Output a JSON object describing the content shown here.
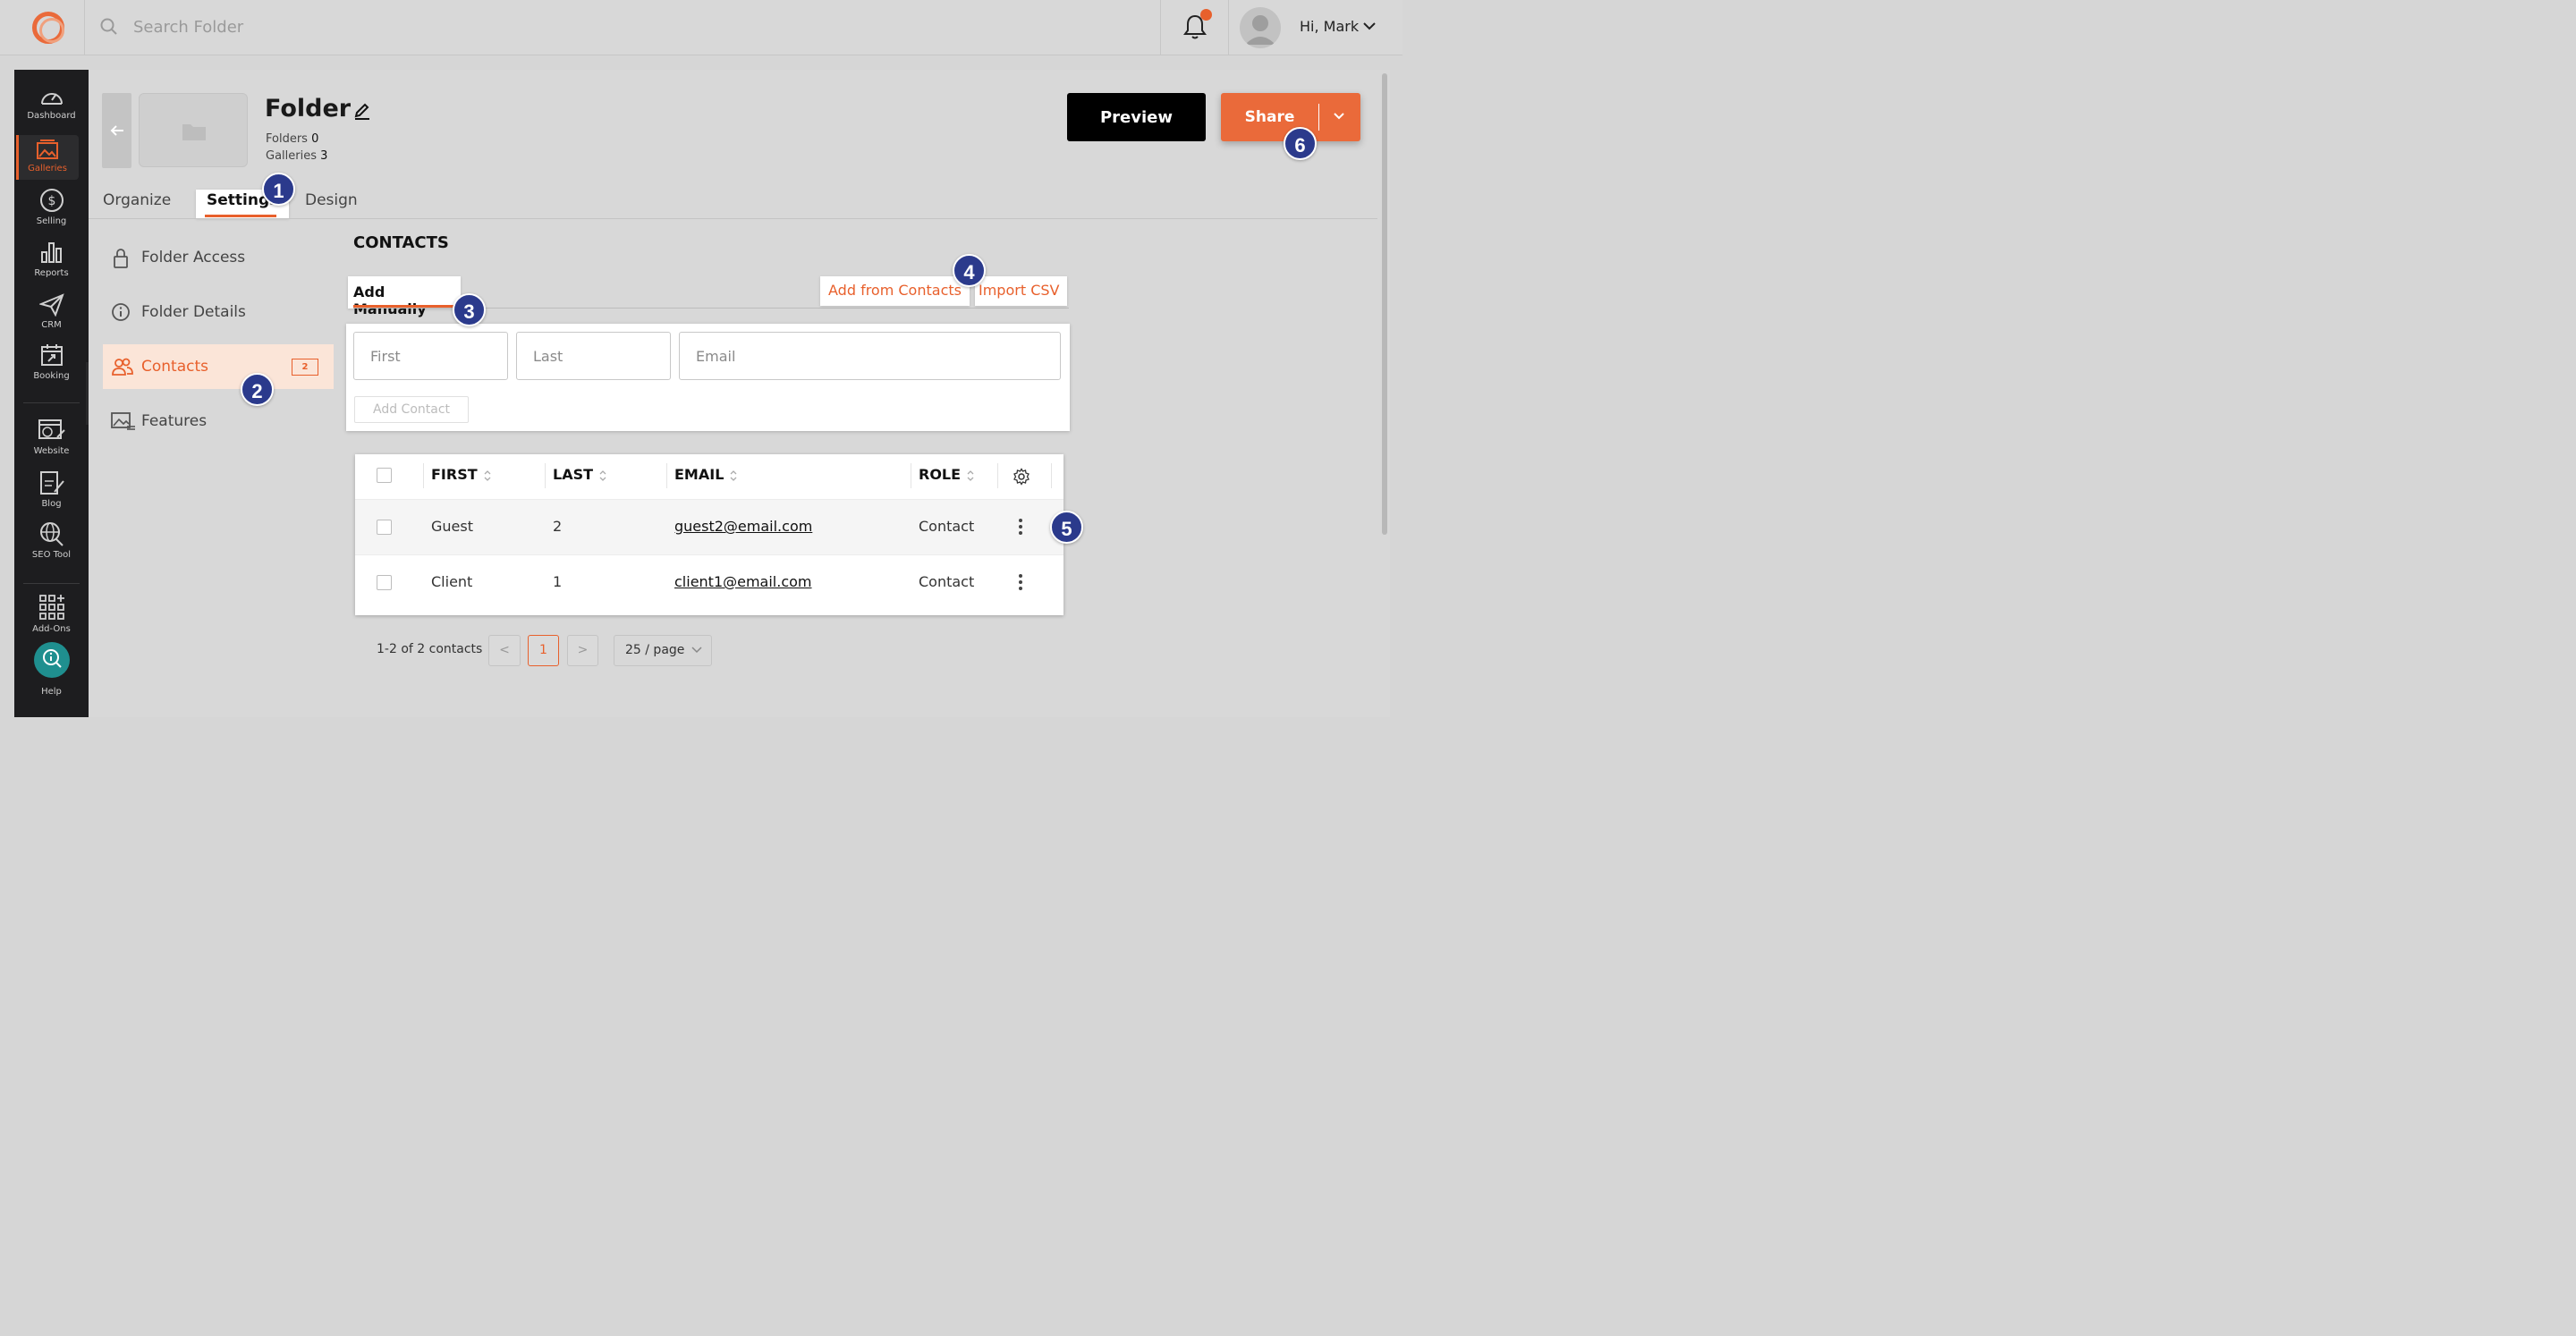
{
  "topbar": {
    "search_placeholder": "Search Folder",
    "greeting": "Hi, Mark",
    "notification_color": "#e8602c"
  },
  "sidebar": {
    "items": [
      {
        "label": "Dashboard",
        "icon": "speedometer-icon"
      },
      {
        "label": "Galleries",
        "icon": "gallery-icon",
        "active": true
      },
      {
        "label": "Selling",
        "icon": "dollar-icon"
      },
      {
        "label": "Reports",
        "icon": "bar-chart-icon"
      },
      {
        "label": "CRM",
        "icon": "paper-plane-icon"
      },
      {
        "label": "Booking",
        "icon": "calendar-icon"
      },
      {
        "label": "Website",
        "icon": "website-icon"
      },
      {
        "label": "Blog",
        "icon": "blog-icon"
      },
      {
        "label": "SEO Tool",
        "icon": "seo-icon"
      },
      {
        "label": "Add-Ons",
        "icon": "grid-plus-icon"
      },
      {
        "label": "Help",
        "icon": "help-icon"
      }
    ],
    "toggle_glyph": "›"
  },
  "folder": {
    "title": "Folder",
    "folders_label": "Folders",
    "folders_count": "0",
    "galleries_label": "Galleries",
    "galleries_count": "3"
  },
  "actions": {
    "preview": "Preview",
    "share": "Share"
  },
  "tabs": [
    {
      "label": "Organize"
    },
    {
      "label": "Settings",
      "active": true
    },
    {
      "label": "Design"
    }
  ],
  "settings_nav": [
    {
      "label": "Folder Access",
      "icon": "lock-icon"
    },
    {
      "label": "Folder Details",
      "icon": "info-icon"
    },
    {
      "label": "Contacts",
      "icon": "users-icon",
      "active": true,
      "badge": "2"
    },
    {
      "label": "Features",
      "icon": "features-icon"
    }
  ],
  "contacts": {
    "heading": "CONTACTS",
    "sub_tab_active": "Add Manually",
    "add_from_contacts": "Add from Contacts",
    "import_csv": "Import CSV",
    "first_placeholder": "First",
    "last_placeholder": "Last",
    "email_placeholder": "Email",
    "add_button": "Add Contact",
    "columns": [
      "FIRST",
      "LAST",
      "EMAIL",
      "ROLE"
    ],
    "rows": [
      {
        "first": "Guest",
        "last": "2",
        "email": "guest2@email.com",
        "role": "Contact"
      },
      {
        "first": "Client",
        "last": "1",
        "email": "client1@email.com",
        "role": "Contact"
      }
    ],
    "pagination": {
      "summary": "1-2 of 2 contacts",
      "prev": "<",
      "current_page": "1",
      "next": ">",
      "per_page": "25 / page"
    }
  },
  "markers": [
    "1",
    "2",
    "3",
    "4",
    "5",
    "6"
  ],
  "colors": {
    "accent": "#e8602c",
    "marker": "#2b3a8c",
    "sidebar": "#1d1d1f"
  }
}
